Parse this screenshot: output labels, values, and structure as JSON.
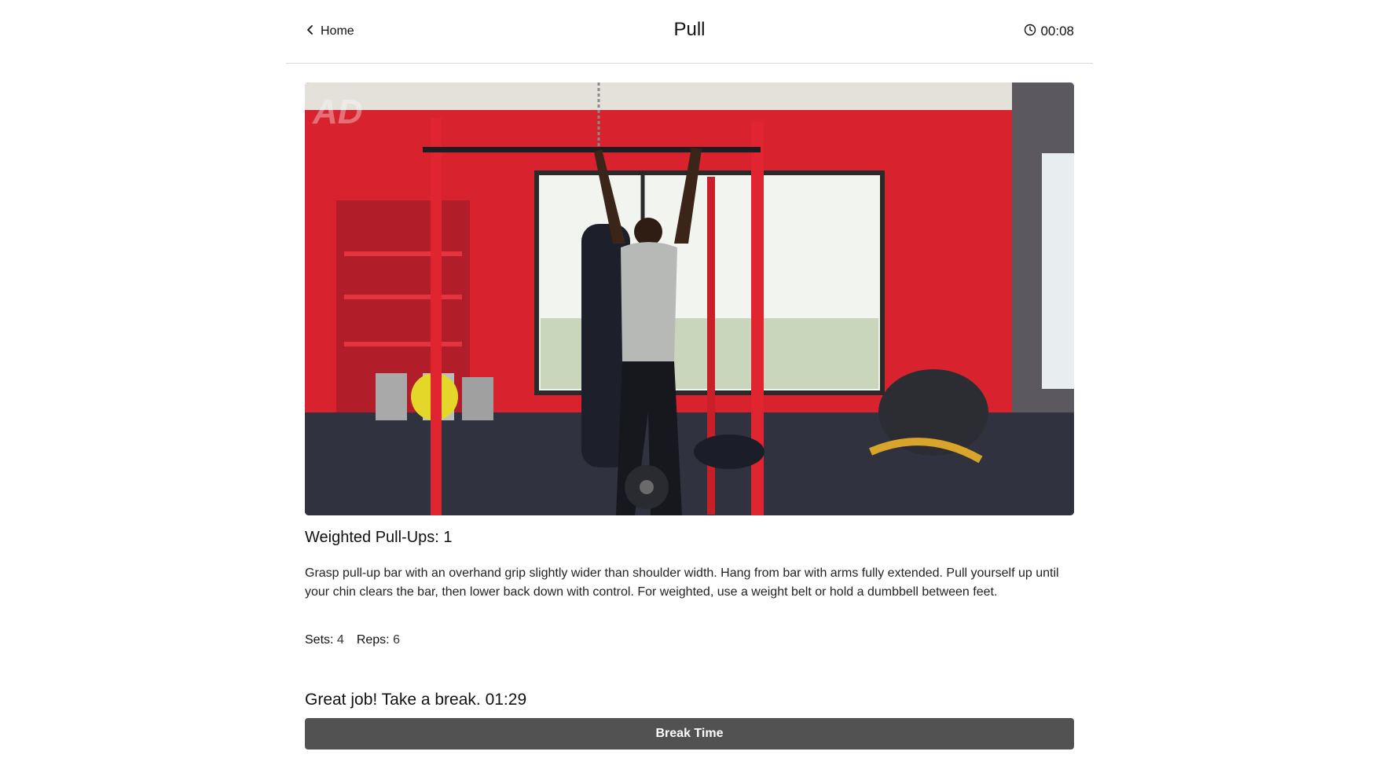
{
  "header": {
    "back_label": "Home",
    "title": "Pull",
    "elapsed_time": "00:08"
  },
  "exercise": {
    "name": "Weighted Pull-Ups: 1",
    "description": "Grasp pull-up bar with an overhand grip slightly wider than shoulder width. Hang from bar with arms fully extended. Pull yourself up until your chin clears the bar, then lower back down with control. For weighted, use a weight belt or hold a dumbbell between feet.",
    "sets_label": "Sets:",
    "sets_value": "4",
    "reps_label": "Reps:",
    "reps_value": "6"
  },
  "rest": {
    "message": "Great job! Take a break. 01:29",
    "button_label": "Break Time"
  },
  "icons": {
    "back": "chevron-left-icon",
    "timer": "clock-icon"
  },
  "colors": {
    "button_bg": "#525252",
    "divider": "#d9d9d9",
    "gym_wall": "#d8232f"
  }
}
